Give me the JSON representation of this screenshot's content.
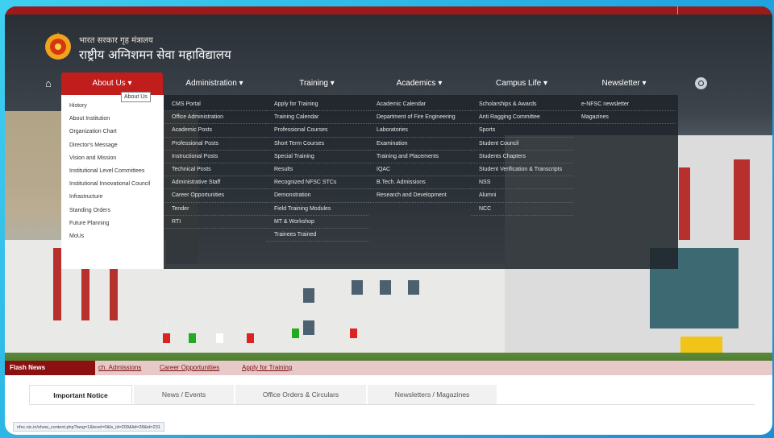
{
  "header": {
    "subtitle": "भारत सरकार गृह मंत्रालय",
    "title": "राष्ट्रीय अग्निशमन सेवा महाविद्यालय"
  },
  "nav": {
    "items": [
      {
        "label": "About Us ▾"
      },
      {
        "label": "Administration ▾"
      },
      {
        "label": "Training ▾"
      },
      {
        "label": "Academics ▾"
      },
      {
        "label": "Campus Life ▾"
      },
      {
        "label": "Newsletter ▾"
      }
    ],
    "tooltip": "About Us"
  },
  "menus": {
    "about": [
      "History",
      "About Institution",
      "Organization Chart",
      "Director's Message",
      "Vision and Mission",
      "Institutional Level Committees",
      "Institutional Innovational Council",
      "Infrastructure",
      "Standing Orders",
      "Future Planning",
      "MoUs"
    ],
    "administration": [
      "CMS Portal",
      "Office Administration",
      "Academic Posts",
      "Professional Posts",
      "Instructional Posts",
      "Technical Posts",
      "Administrative Staff",
      "Career Opportunities",
      "Tender",
      "RTI"
    ],
    "training": [
      "Apply for Training",
      "Training Calendar",
      "Professional Courses",
      "Short Term Courses",
      "Special Training",
      "Results",
      "Recognized NFSC STCs",
      "Demonstration",
      "Field Training Modules",
      "MT & Workshop",
      "Trainees Trained"
    ],
    "academics": [
      "Academic Calendar",
      "Department of Fire Engineering",
      "Laboratories",
      "Examination",
      "Training and Placements",
      "IQAC",
      "B.Tech. Admissions",
      "Research and Development"
    ],
    "campus": [
      "Scholarships & Awards",
      "Anti Ragging Committee",
      "Sports",
      "Student Council",
      "Students Chapters",
      "Student Verification & Transcripts",
      "NSS",
      "Alumni",
      "NCC"
    ],
    "newsletter": [
      "e-NFSC newsletter",
      "Magazines"
    ]
  },
  "flash": {
    "label": "Flash News",
    "links": [
      "ch. Admissions",
      "Career Opportunities",
      "Apply for Training"
    ]
  },
  "tabs": [
    "Important Notice",
    "News / Events",
    "Office Orders & Circulars",
    "Newsletters / Magazines"
  ],
  "status_url": "nfsc.nic.in/show_content.php?lang=1&level=0&ls_id=209&lid=28&id=231",
  "colors": {
    "accent": "#c21d1d",
    "flash_bg": "#8b1111",
    "dropdown_dark": "#1e242a"
  }
}
